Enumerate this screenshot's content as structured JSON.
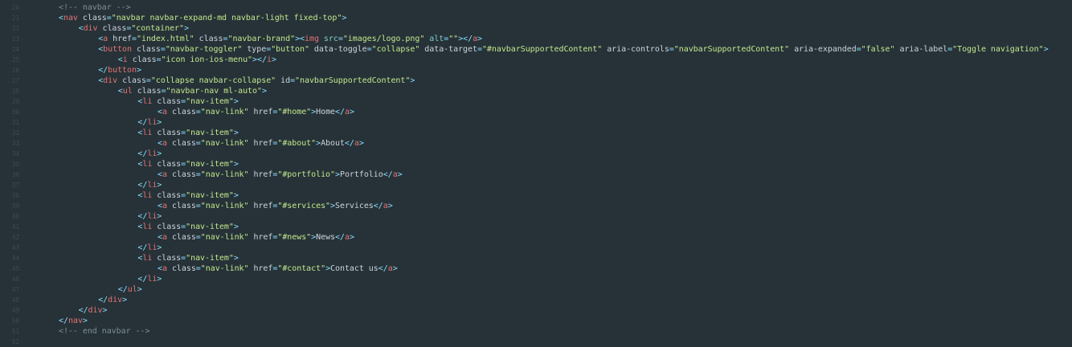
{
  "editor": {
    "lines": [
      {
        "n": "20",
        "indent": 0,
        "tokens": [
          {
            "t": "comment",
            "v": "<!-- navbar -->"
          }
        ]
      },
      {
        "n": "21",
        "indent": 0,
        "tokens": [
          {
            "t": "punct",
            "v": "<"
          },
          {
            "t": "tag",
            "v": "nav"
          },
          {
            "t": "attr",
            "v": " class"
          },
          {
            "t": "punct",
            "v": "="
          },
          {
            "t": "str",
            "v": "\"navbar navbar-expand-md navbar-light fixed-top\""
          },
          {
            "t": "punct",
            "v": ">"
          }
        ]
      },
      {
        "n": "22",
        "indent": 1,
        "tokens": [
          {
            "t": "punct",
            "v": "<"
          },
          {
            "t": "tag",
            "v": "div"
          },
          {
            "t": "attr",
            "v": " class"
          },
          {
            "t": "punct",
            "v": "="
          },
          {
            "t": "str",
            "v": "\"container\""
          },
          {
            "t": "punct",
            "v": ">"
          }
        ]
      },
      {
        "n": "23",
        "indent": 2,
        "tokens": [
          {
            "t": "punct",
            "v": "<"
          },
          {
            "t": "tag",
            "v": "a"
          },
          {
            "t": "attr",
            "v": " href"
          },
          {
            "t": "punct",
            "v": "="
          },
          {
            "t": "str",
            "v": "\"index.html\""
          },
          {
            "t": "attr",
            "v": " class"
          },
          {
            "t": "punct",
            "v": "="
          },
          {
            "t": "str",
            "v": "\"navbar-brand\""
          },
          {
            "t": "punct",
            "v": "><"
          },
          {
            "t": "tag",
            "v": "img"
          },
          {
            "t": "attr2",
            "v": " src"
          },
          {
            "t": "punct",
            "v": "="
          },
          {
            "t": "str",
            "v": "\"images/logo.png\""
          },
          {
            "t": "attr2",
            "v": " alt"
          },
          {
            "t": "punct",
            "v": "="
          },
          {
            "t": "str",
            "v": "\"\""
          },
          {
            "t": "punct",
            "v": "></"
          },
          {
            "t": "tag",
            "v": "a"
          },
          {
            "t": "punct",
            "v": ">"
          }
        ]
      },
      {
        "n": "24",
        "indent": 2,
        "tokens": [
          {
            "t": "punct",
            "v": "<"
          },
          {
            "t": "tag",
            "v": "button"
          },
          {
            "t": "attr",
            "v": " class"
          },
          {
            "t": "punct",
            "v": "="
          },
          {
            "t": "str",
            "v": "\"navbar-toggler\""
          },
          {
            "t": "attr",
            "v": " type"
          },
          {
            "t": "punct",
            "v": "="
          },
          {
            "t": "str",
            "v": "\"button\""
          },
          {
            "t": "attr",
            "v": " data-toggle"
          },
          {
            "t": "punct",
            "v": "="
          },
          {
            "t": "str",
            "v": "\"collapse\""
          },
          {
            "t": "attr",
            "v": " data-target"
          },
          {
            "t": "punct",
            "v": "="
          },
          {
            "t": "str",
            "v": "\"#navbarSupportedContent\""
          },
          {
            "t": "attr",
            "v": " aria-controls"
          },
          {
            "t": "punct",
            "v": "="
          },
          {
            "t": "str",
            "v": "\"navbarSupportedContent\""
          },
          {
            "t": "attr",
            "v": " aria-expanded"
          },
          {
            "t": "punct",
            "v": "="
          },
          {
            "t": "str",
            "v": "\"false\""
          },
          {
            "t": "attr",
            "v": " aria-label"
          },
          {
            "t": "punct",
            "v": "="
          },
          {
            "t": "str",
            "v": "\"Toggle navigation\""
          },
          {
            "t": "punct",
            "v": ">"
          }
        ]
      },
      {
        "n": "25",
        "indent": 3,
        "tokens": [
          {
            "t": "punct",
            "v": "<"
          },
          {
            "t": "tag",
            "v": "i"
          },
          {
            "t": "attr",
            "v": " class"
          },
          {
            "t": "punct",
            "v": "="
          },
          {
            "t": "str",
            "v": "\"icon ion-ios-menu\""
          },
          {
            "t": "punct",
            "v": "></"
          },
          {
            "t": "tag",
            "v": "i"
          },
          {
            "t": "punct",
            "v": ">"
          }
        ]
      },
      {
        "n": "26",
        "indent": 2,
        "tokens": [
          {
            "t": "punct",
            "v": "</"
          },
          {
            "t": "tag",
            "v": "button"
          },
          {
            "t": "punct",
            "v": ">"
          }
        ]
      },
      {
        "n": "27",
        "indent": 2,
        "tokens": [
          {
            "t": "punct",
            "v": "<"
          },
          {
            "t": "tag",
            "v": "div"
          },
          {
            "t": "attr",
            "v": " class"
          },
          {
            "t": "punct",
            "v": "="
          },
          {
            "t": "str",
            "v": "\"collapse navbar-collapse\""
          },
          {
            "t": "attr",
            "v": " id"
          },
          {
            "t": "punct",
            "v": "="
          },
          {
            "t": "str",
            "v": "\"navbarSupportedContent\""
          },
          {
            "t": "punct",
            "v": ">"
          }
        ]
      },
      {
        "n": "28",
        "indent": 3,
        "tokens": [
          {
            "t": "punct",
            "v": "<"
          },
          {
            "t": "tag",
            "v": "ul"
          },
          {
            "t": "attr",
            "v": " class"
          },
          {
            "t": "punct",
            "v": "="
          },
          {
            "t": "str",
            "v": "\"navbar-nav ml-auto\""
          },
          {
            "t": "punct",
            "v": ">"
          }
        ]
      },
      {
        "n": "29",
        "indent": 4,
        "tokens": [
          {
            "t": "punct",
            "v": "<"
          },
          {
            "t": "tag",
            "v": "li"
          },
          {
            "t": "attr",
            "v": " class"
          },
          {
            "t": "punct",
            "v": "="
          },
          {
            "t": "str",
            "v": "\"nav-item\""
          },
          {
            "t": "punct",
            "v": ">"
          }
        ]
      },
      {
        "n": "30",
        "indent": 5,
        "tokens": [
          {
            "t": "punct",
            "v": "<"
          },
          {
            "t": "tag",
            "v": "a"
          },
          {
            "t": "attr",
            "v": " class"
          },
          {
            "t": "punct",
            "v": "="
          },
          {
            "t": "str",
            "v": "\"nav-link\""
          },
          {
            "t": "attr",
            "v": " href"
          },
          {
            "t": "punct",
            "v": "="
          },
          {
            "t": "str",
            "v": "\"#home\""
          },
          {
            "t": "punct",
            "v": ">"
          },
          {
            "t": "text",
            "v": "Home"
          },
          {
            "t": "punct",
            "v": "</"
          },
          {
            "t": "tag",
            "v": "a"
          },
          {
            "t": "punct",
            "v": ">"
          }
        ]
      },
      {
        "n": "31",
        "indent": 4,
        "tokens": [
          {
            "t": "punct",
            "v": "</"
          },
          {
            "t": "tag",
            "v": "li"
          },
          {
            "t": "punct",
            "v": ">"
          }
        ]
      },
      {
        "n": "32",
        "indent": 4,
        "tokens": [
          {
            "t": "punct",
            "v": "<"
          },
          {
            "t": "tag",
            "v": "li"
          },
          {
            "t": "attr",
            "v": " class"
          },
          {
            "t": "punct",
            "v": "="
          },
          {
            "t": "str",
            "v": "\"nav-item\""
          },
          {
            "t": "punct",
            "v": ">"
          }
        ]
      },
      {
        "n": "33",
        "indent": 5,
        "tokens": [
          {
            "t": "punct",
            "v": "<"
          },
          {
            "t": "tag",
            "v": "a"
          },
          {
            "t": "attr",
            "v": " class"
          },
          {
            "t": "punct",
            "v": "="
          },
          {
            "t": "str",
            "v": "\"nav-link\""
          },
          {
            "t": "attr",
            "v": " href"
          },
          {
            "t": "punct",
            "v": "="
          },
          {
            "t": "str",
            "v": "\"#about\""
          },
          {
            "t": "punct",
            "v": ">"
          },
          {
            "t": "text",
            "v": "About"
          },
          {
            "t": "punct",
            "v": "</"
          },
          {
            "t": "tag",
            "v": "a"
          },
          {
            "t": "punct",
            "v": ">"
          }
        ]
      },
      {
        "n": "34",
        "indent": 4,
        "tokens": [
          {
            "t": "punct",
            "v": "</"
          },
          {
            "t": "tag",
            "v": "li"
          },
          {
            "t": "punct",
            "v": ">"
          }
        ]
      },
      {
        "n": "35",
        "indent": 4,
        "tokens": [
          {
            "t": "punct",
            "v": "<"
          },
          {
            "t": "tag",
            "v": "li"
          },
          {
            "t": "attr",
            "v": " class"
          },
          {
            "t": "punct",
            "v": "="
          },
          {
            "t": "str",
            "v": "\"nav-item\""
          },
          {
            "t": "punct",
            "v": ">"
          }
        ]
      },
      {
        "n": "36",
        "indent": 5,
        "tokens": [
          {
            "t": "punct",
            "v": "<"
          },
          {
            "t": "tag",
            "v": "a"
          },
          {
            "t": "attr",
            "v": " class"
          },
          {
            "t": "punct",
            "v": "="
          },
          {
            "t": "str",
            "v": "\"nav-link\""
          },
          {
            "t": "attr",
            "v": " href"
          },
          {
            "t": "punct",
            "v": "="
          },
          {
            "t": "str",
            "v": "\"#portfolio\""
          },
          {
            "t": "punct",
            "v": ">"
          },
          {
            "t": "text",
            "v": "Portfolio"
          },
          {
            "t": "punct",
            "v": "</"
          },
          {
            "t": "tag",
            "v": "a"
          },
          {
            "t": "punct",
            "v": ">"
          }
        ]
      },
      {
        "n": "37",
        "indent": 4,
        "tokens": [
          {
            "t": "punct",
            "v": "</"
          },
          {
            "t": "tag",
            "v": "li"
          },
          {
            "t": "punct",
            "v": ">"
          }
        ]
      },
      {
        "n": "38",
        "indent": 4,
        "tokens": [
          {
            "t": "punct",
            "v": "<"
          },
          {
            "t": "tag",
            "v": "li"
          },
          {
            "t": "attr",
            "v": " class"
          },
          {
            "t": "punct",
            "v": "="
          },
          {
            "t": "str",
            "v": "\"nav-item\""
          },
          {
            "t": "punct",
            "v": ">"
          }
        ]
      },
      {
        "n": "39",
        "indent": 5,
        "tokens": [
          {
            "t": "punct",
            "v": "<"
          },
          {
            "t": "tag",
            "v": "a"
          },
          {
            "t": "attr",
            "v": " class"
          },
          {
            "t": "punct",
            "v": "="
          },
          {
            "t": "str",
            "v": "\"nav-link\""
          },
          {
            "t": "attr",
            "v": " href"
          },
          {
            "t": "punct",
            "v": "="
          },
          {
            "t": "str",
            "v": "\"#services\""
          },
          {
            "t": "punct",
            "v": ">"
          },
          {
            "t": "text",
            "v": "Services"
          },
          {
            "t": "punct",
            "v": "</"
          },
          {
            "t": "tag",
            "v": "a"
          },
          {
            "t": "punct",
            "v": ">"
          }
        ]
      },
      {
        "n": "40",
        "indent": 4,
        "tokens": [
          {
            "t": "punct",
            "v": "</"
          },
          {
            "t": "tag",
            "v": "li"
          },
          {
            "t": "punct",
            "v": ">"
          }
        ]
      },
      {
        "n": "41",
        "indent": 4,
        "tokens": [
          {
            "t": "punct",
            "v": "<"
          },
          {
            "t": "tag",
            "v": "li"
          },
          {
            "t": "attr",
            "v": " class"
          },
          {
            "t": "punct",
            "v": "="
          },
          {
            "t": "str",
            "v": "\"nav-item\""
          },
          {
            "t": "punct",
            "v": ">"
          }
        ]
      },
      {
        "n": "42",
        "indent": 5,
        "tokens": [
          {
            "t": "punct",
            "v": "<"
          },
          {
            "t": "tag",
            "v": "a"
          },
          {
            "t": "attr",
            "v": " class"
          },
          {
            "t": "punct",
            "v": "="
          },
          {
            "t": "str",
            "v": "\"nav-link\""
          },
          {
            "t": "attr",
            "v": " href"
          },
          {
            "t": "punct",
            "v": "="
          },
          {
            "t": "str",
            "v": "\"#news\""
          },
          {
            "t": "punct",
            "v": ">"
          },
          {
            "t": "text",
            "v": "News"
          },
          {
            "t": "punct",
            "v": "</"
          },
          {
            "t": "tag",
            "v": "a"
          },
          {
            "t": "punct",
            "v": ">"
          }
        ]
      },
      {
        "n": "43",
        "indent": 4,
        "tokens": [
          {
            "t": "punct",
            "v": "</"
          },
          {
            "t": "tag",
            "v": "li"
          },
          {
            "t": "punct",
            "v": ">"
          }
        ]
      },
      {
        "n": "44",
        "indent": 4,
        "tokens": [
          {
            "t": "punct",
            "v": "<"
          },
          {
            "t": "tag",
            "v": "li"
          },
          {
            "t": "attr",
            "v": " class"
          },
          {
            "t": "punct",
            "v": "="
          },
          {
            "t": "str",
            "v": "\"nav-item\""
          },
          {
            "t": "punct",
            "v": ">"
          }
        ]
      },
      {
        "n": "45",
        "indent": 5,
        "tokens": [
          {
            "t": "punct",
            "v": "<"
          },
          {
            "t": "tag",
            "v": "a"
          },
          {
            "t": "attr",
            "v": " class"
          },
          {
            "t": "punct",
            "v": "="
          },
          {
            "t": "str",
            "v": "\"nav-link\""
          },
          {
            "t": "attr",
            "v": " href"
          },
          {
            "t": "punct",
            "v": "="
          },
          {
            "t": "str",
            "v": "\"#contact\""
          },
          {
            "t": "punct",
            "v": ">"
          },
          {
            "t": "text",
            "v": "Contact us"
          },
          {
            "t": "punct",
            "v": "</"
          },
          {
            "t": "tag",
            "v": "a"
          },
          {
            "t": "punct",
            "v": ">"
          }
        ]
      },
      {
        "n": "46",
        "indent": 4,
        "tokens": [
          {
            "t": "punct",
            "v": "</"
          },
          {
            "t": "tag",
            "v": "li"
          },
          {
            "t": "punct",
            "v": ">"
          }
        ]
      },
      {
        "n": "47",
        "indent": 3,
        "tokens": [
          {
            "t": "punct",
            "v": "</"
          },
          {
            "t": "tag",
            "v": "ul"
          },
          {
            "t": "punct",
            "v": ">"
          }
        ]
      },
      {
        "n": "48",
        "indent": 2,
        "tokens": [
          {
            "t": "punct",
            "v": "</"
          },
          {
            "t": "tag",
            "v": "div"
          },
          {
            "t": "punct",
            "v": ">"
          }
        ]
      },
      {
        "n": "49",
        "indent": 1,
        "tokens": [
          {
            "t": "punct",
            "v": "</"
          },
          {
            "t": "tag",
            "v": "div"
          },
          {
            "t": "punct",
            "v": ">"
          }
        ]
      },
      {
        "n": "50",
        "indent": 0,
        "tokens": [
          {
            "t": "punct",
            "v": "</"
          },
          {
            "t": "tag",
            "v": "nav"
          },
          {
            "t": "punct",
            "v": ">"
          }
        ]
      },
      {
        "n": "51",
        "indent": 0,
        "tokens": [
          {
            "t": "comment",
            "v": "<!-- end navbar -->"
          }
        ]
      },
      {
        "n": "52",
        "indent": 0,
        "tokens": []
      }
    ]
  }
}
